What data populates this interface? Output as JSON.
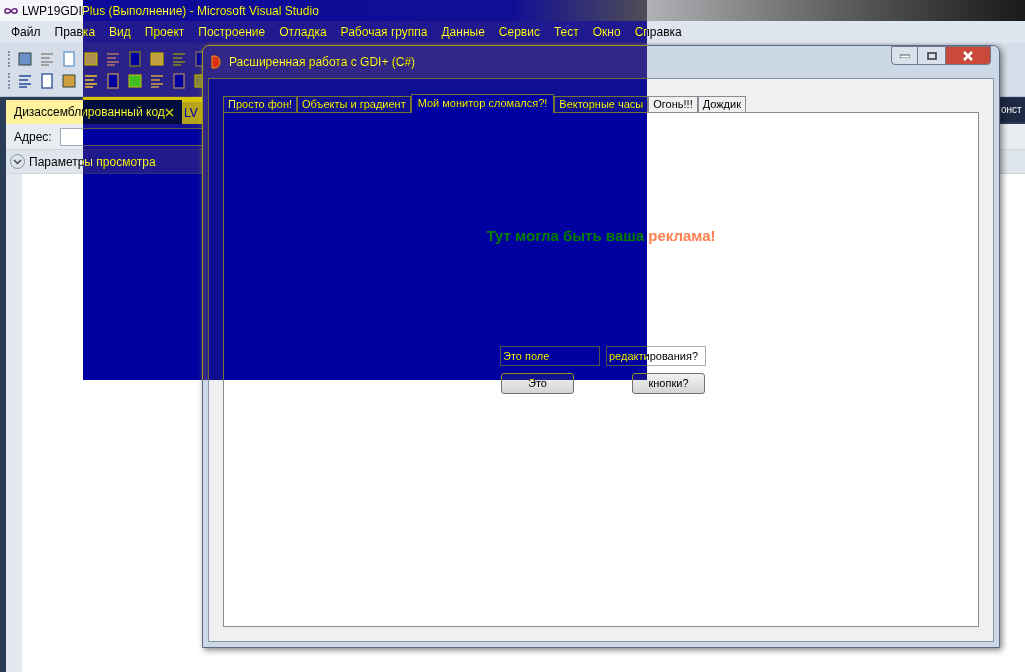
{
  "vs": {
    "title": "LWP19GDIPlus (Выполнение) - Microsoft Visual Studio",
    "menu": [
      "Файл",
      "Правка",
      "Вид",
      "Проект",
      "Построение",
      "Отладка",
      "Рабочая группа",
      "Данные",
      "Сервис",
      "Тест",
      "Окно",
      "Справка"
    ],
    "doc_tabs": [
      {
        "label": "Дизассемблированный код",
        "selected": true
      },
      {
        "label": "LV",
        "selected": false
      }
    ],
    "address_label": "Адрес:",
    "options_label": "Параметры просмотра",
    "right_tab": "онст"
  },
  "form": {
    "title": "Расширенная работа с GDI+ (C#)",
    "tabs": [
      {
        "label": "Просто фон!",
        "selected": false
      },
      {
        "label": "Объекты и градиент",
        "selected": false
      },
      {
        "label": "Мой монитор сломался?!",
        "selected": true
      },
      {
        "label": "Векторные часы",
        "selected": false
      },
      {
        "label": "Огонь!!!",
        "selected": false
      },
      {
        "label": "Дождик",
        "selected": false
      }
    ],
    "ad_text": "Тут могла быть ваша реклама!",
    "fields": [
      {
        "value": "Это поле"
      },
      {
        "value": "редактирования?"
      }
    ],
    "buttons": [
      "Это",
      "кнопки?"
    ]
  }
}
